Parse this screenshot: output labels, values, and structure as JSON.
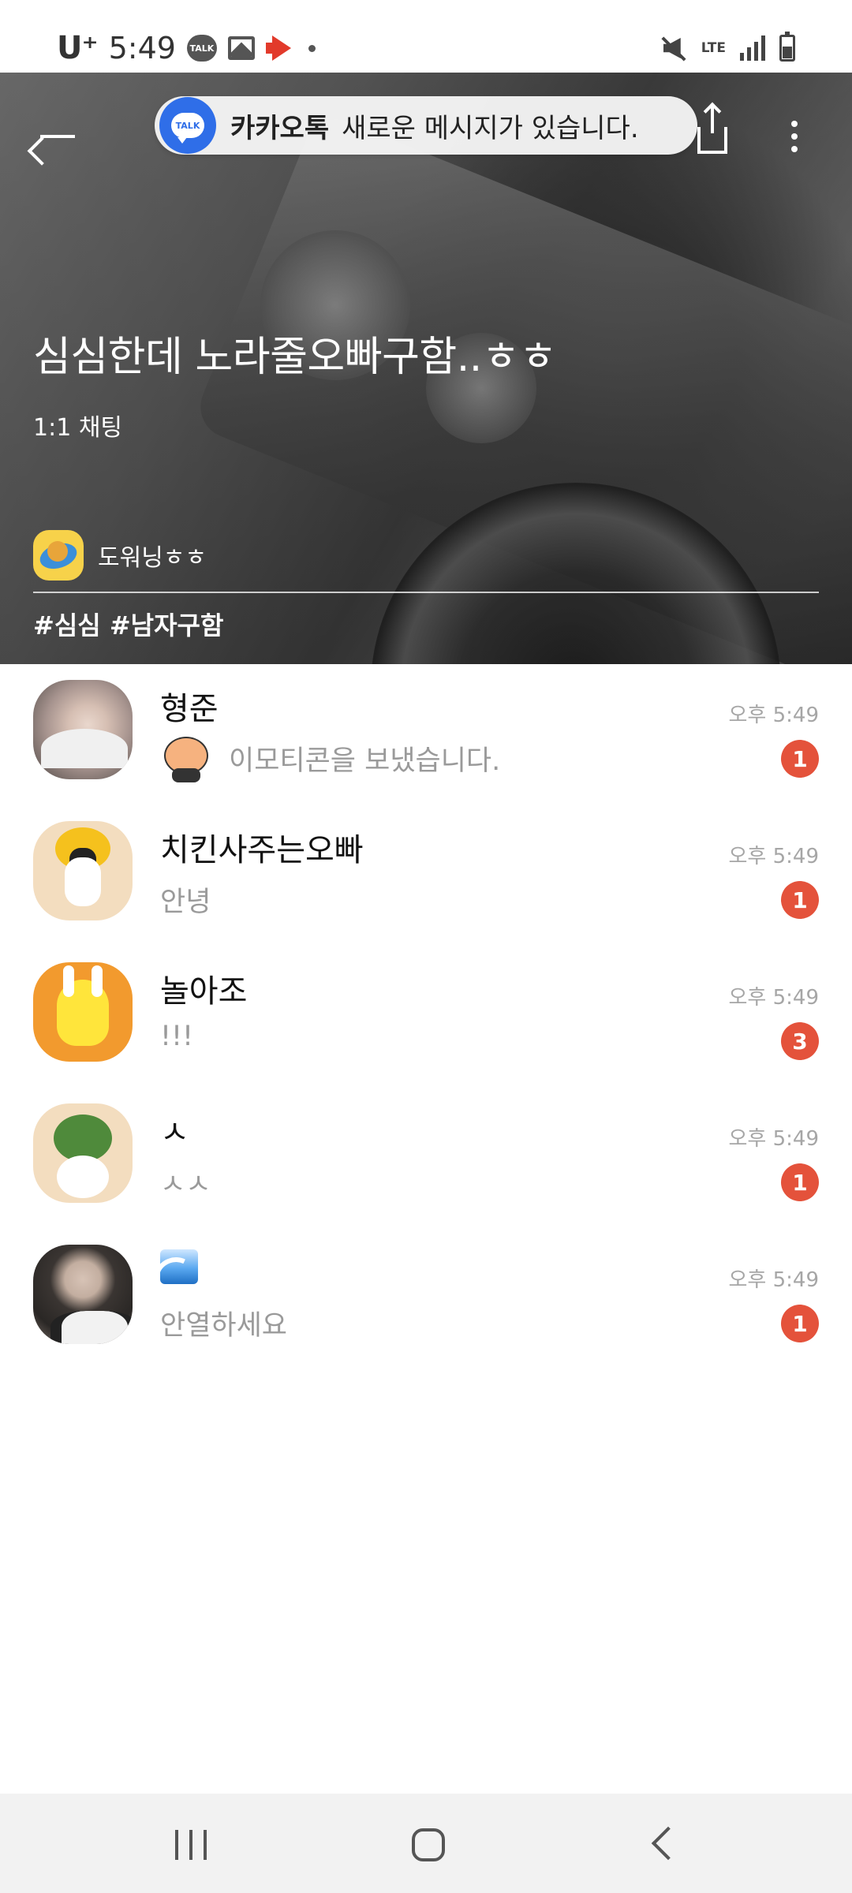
{
  "status_bar": {
    "carrier": "U⁺",
    "time": "5:49",
    "talk_label": "TALK",
    "network": "LTE",
    "icons": [
      "talk-icon",
      "image-icon",
      "megaphone-icon",
      "dot-icon",
      "mute-icon",
      "lte-icon",
      "signal-icon",
      "battery-icon"
    ]
  },
  "header": {
    "notification": {
      "app_name": "카카오톡",
      "message": "새로운 메시지가 있습니다.",
      "icon_label": "TALK"
    },
    "room_title": "심심한데 노라줄오빠구함..ㅎㅎ",
    "room_type": "1:1 채팅",
    "owner_name": "도워닝ㅎㅎ",
    "tags": "#심심 #남자구함"
  },
  "chats": [
    {
      "name": "형준",
      "message": "이모티콘을 보냈습니다.",
      "time": "오후 5:49",
      "unread": "1"
    },
    {
      "name": "치킨사주는오빠",
      "message": "안녕",
      "time": "오후 5:49",
      "unread": "1"
    },
    {
      "name": "놀아조",
      "message": "!!!",
      "time": "오후 5:49",
      "unread": "3"
    },
    {
      "name": "ㅅ",
      "message": "ㅅㅅ",
      "time": "오후 5:49",
      "unread": "1"
    },
    {
      "name": "",
      "message": "안열하세요",
      "time": "오후 5:49",
      "unread": "1"
    }
  ],
  "colors": {
    "badge": "#e4523b",
    "toast_icon": "#2f6ee8",
    "muted_text": "#9a9a9a"
  }
}
